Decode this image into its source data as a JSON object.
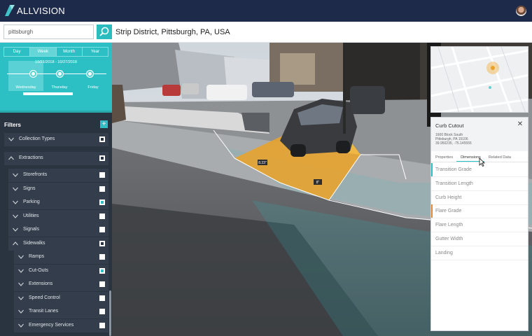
{
  "app": {
    "brand": "ALLVISION"
  },
  "search": {
    "value": "pittsburgh"
  },
  "location": {
    "title": "Strip District, Pittsburgh, PA, USA"
  },
  "time_panel": {
    "period_tabs": [
      {
        "label": "Day",
        "active": false
      },
      {
        "label": "Week",
        "active": true
      },
      {
        "label": "Month",
        "active": false
      },
      {
        "label": "Year",
        "active": false
      }
    ],
    "date_range": "10/21/2018 - 10/27/2018",
    "days": [
      {
        "label": "Wednesday",
        "selected": true
      },
      {
        "label": "Thursday",
        "selected": false
      },
      {
        "label": "Friday",
        "selected": false
      }
    ]
  },
  "filters": {
    "header": "Filters",
    "add_label": "+",
    "items": [
      {
        "label": "Collection Types",
        "level": 0,
        "expanded": false,
        "checked": "partial"
      },
      {
        "label": "Extractions",
        "level": 0,
        "expanded": true,
        "checked": "partial"
      },
      {
        "label": "Storefronts",
        "level": 1,
        "expanded": false,
        "checked": "none"
      },
      {
        "label": "Signs",
        "level": 1,
        "expanded": false,
        "checked": "none"
      },
      {
        "label": "Parking",
        "level": 1,
        "expanded": false,
        "checked": "teal"
      },
      {
        "label": "Utilities",
        "level": 1,
        "expanded": false,
        "checked": "none"
      },
      {
        "label": "Signals",
        "level": 1,
        "expanded": false,
        "checked": "none"
      },
      {
        "label": "Sidewalks",
        "level": 1,
        "expanded": true,
        "checked": "partial"
      },
      {
        "label": "Ramps",
        "level": 2,
        "expanded": false,
        "checked": "none"
      },
      {
        "label": "Cut-Outs",
        "level": 2,
        "expanded": false,
        "checked": "teal"
      },
      {
        "label": "Extensions",
        "level": 2,
        "expanded": false,
        "checked": "none"
      },
      {
        "label": "Speed Control",
        "level": 2,
        "expanded": false,
        "checked": "none"
      },
      {
        "label": "Transit Lanes",
        "level": 2,
        "expanded": false,
        "checked": "none"
      },
      {
        "label": "Emergency Services",
        "level": 2,
        "expanded": false,
        "checked": "none"
      }
    ]
  },
  "scene": {
    "measure_labels": [
      "8.23\"",
      "8\""
    ]
  },
  "detail": {
    "title": "Curb Cutout",
    "close_label": "✕",
    "address_line1": "1600 Block South",
    "address_line2": "Pittsburgh, PA 15106",
    "coords": "39.950235, -75.145555",
    "tabs": [
      {
        "label": "Properties",
        "active": false
      },
      {
        "label": "Dimensions",
        "active": true
      },
      {
        "label": "Related Data",
        "active": false
      }
    ],
    "rows": [
      {
        "label": "Transition Grade",
        "marker": "#2cbfc4"
      },
      {
        "label": "Transition Length",
        "marker": ""
      },
      {
        "label": "Curb Height",
        "marker": ""
      },
      {
        "label": "Flare Grade",
        "marker": "#e58a3a"
      },
      {
        "label": "Flare Length",
        "marker": ""
      },
      {
        "label": "Gutter Width",
        "marker": ""
      },
      {
        "label": "Landing",
        "marker": ""
      }
    ]
  },
  "colors": {
    "accent": "#2cbfc4",
    "topbar": "#1e2a4a",
    "highlight": "#e8a32a"
  }
}
